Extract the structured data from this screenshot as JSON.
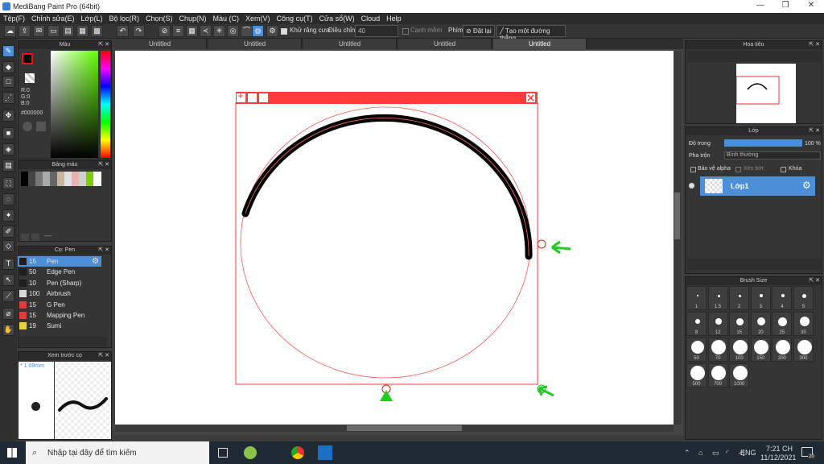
{
  "titlebar": {
    "title": "MediBang Paint Pro (64bit)"
  },
  "menu": [
    "Tệp(F)",
    "Chỉnh sửa(E)",
    "Lớp(L)",
    "Bộ lọc(R)",
    "Chọn(S)",
    "Chụp(N)",
    "Màu (C)",
    "Xem(V)",
    "Công cụ(T)",
    "Cửa sổ(W)",
    "Cloud",
    "Help"
  ],
  "toolbar": {
    "antialias_label": "Khử răng cưa",
    "adjust_label": "Điều chỉnh",
    "adjust_value": "40",
    "edge_label": "Cạnh mềm",
    "key_label": "Phím",
    "reset_label": "Đặt lại",
    "straight_line_label": "Tạo một đường thẳng"
  },
  "tabs": [
    "Untitled",
    "Untitled",
    "Untitled",
    "Untitled",
    "Untitled"
  ],
  "color_panel": {
    "title": "Màu",
    "r": "R:0",
    "g": "G:0",
    "b": "B:0",
    "hex": "#000000"
  },
  "palette_panel": {
    "title": "Bảng màu",
    "footer": "----"
  },
  "pen_panel": {
    "title": "Cọ: Pen",
    "items": [
      {
        "size": "15",
        "name": "Pen",
        "color": "#1e1e1e",
        "selected": true
      },
      {
        "size": "50",
        "name": "Edge Pen",
        "color": "#1e1e1e"
      },
      {
        "size": "10",
        "name": "Pen (Sharp)",
        "color": "#1e1e1e"
      },
      {
        "size": "100",
        "name": "Airbrush",
        "color": "#d9d9d9"
      },
      {
        "size": "15",
        "name": "G Pen",
        "color": "#e23b3b"
      },
      {
        "size": "15",
        "name": "Mapping Pen",
        "color": "#e23b3b"
      },
      {
        "size": "19",
        "name": "Sumi",
        "color": "#e8d33a"
      }
    ]
  },
  "preview_panel": {
    "title": "Xem trước cọ",
    "size": "1.09mm"
  },
  "navigator": {
    "title": "Hoa tiêu"
  },
  "layer_panel": {
    "title": "Lớp",
    "opacity_label": "Độ trong",
    "opacity_value": "100 %",
    "blend_label": "Pha trộn",
    "blend_value": "Bình thường",
    "protect_alpha": "Bảo vệ alpha",
    "clip": "Xén bớt",
    "lock": "Khóa",
    "layer_name": "Lớp1"
  },
  "brush_size": {
    "title": "Brush Size",
    "sizes": [
      "1",
      "1.5",
      "2",
      "3",
      "4",
      "5",
      "8",
      "12",
      "15",
      "20",
      "25",
      "30",
      "50",
      "70",
      "100",
      "150",
      "200",
      "300",
      "500",
      "700",
      "1000"
    ]
  },
  "taskbar": {
    "search_placeholder": "Nhập tại đây để tìm kiếm",
    "lang": "ENG",
    "time": "7:21 CH",
    "date": "11/12/2021",
    "notif_count": "20"
  },
  "colors": {
    "accent": "#4a8fd8",
    "frame": "#ff3b3b",
    "highlight": "#22cc22"
  }
}
